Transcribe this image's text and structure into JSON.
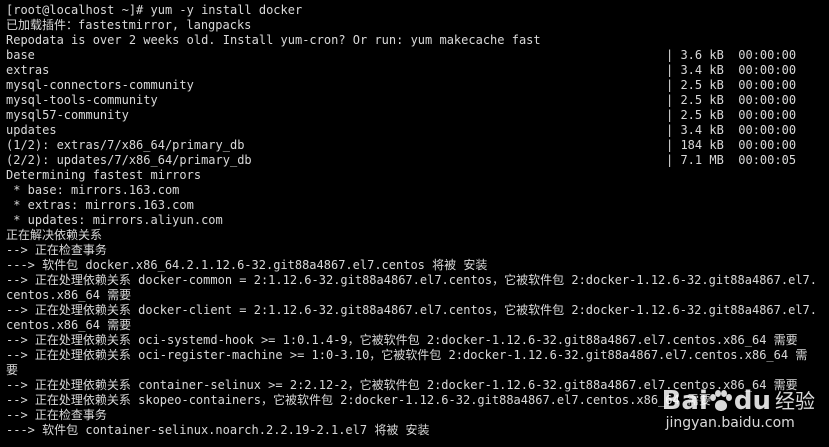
{
  "terminal": {
    "lines_top": [
      "[root@localhost ~]# yum -y install docker",
      "已加载插件：fastestmirror, langpacks",
      "Repodata is over 2 weeks old. Install yum-cron? Or run: yum makecache fast"
    ],
    "repos": [
      {
        "name": "base",
        "stat": "| 3.6 kB  00:00:00"
      },
      {
        "name": "extras",
        "stat": "| 3.4 kB  00:00:00"
      },
      {
        "name": "mysql-connectors-community",
        "stat": "| 2.5 kB  00:00:00"
      },
      {
        "name": "mysql-tools-community",
        "stat": "| 2.5 kB  00:00:00"
      },
      {
        "name": "mysql57-community",
        "stat": "| 2.5 kB  00:00:00"
      },
      {
        "name": "updates",
        "stat": "| 3.4 kB  00:00:00"
      },
      {
        "name": "(1/2): extras/7/x86_64/primary_db",
        "stat": "| 184 kB  00:00:00"
      },
      {
        "name": "(2/2): updates/7/x86_64/primary_db",
        "stat": "| 7.1 MB  00:00:05"
      }
    ],
    "lines_bottom": [
      "Determining fastest mirrors",
      " * base: mirrors.163.com",
      " * extras: mirrors.163.com",
      " * updates: mirrors.aliyun.com",
      "正在解决依赖关系",
      "--> 正在检查事务",
      "---> 软件包 docker.x86_64.2.1.12.6-32.git88a4867.el7.centos 将被 安装",
      "--> 正在处理依赖关系 docker-common = 2:1.12.6-32.git88a4867.el7.centos，它被软件包 2:docker-1.12.6-32.git88a4867.el7.",
      "centos.x86_64 需要",
      "--> 正在处理依赖关系 docker-client = 2:1.12.6-32.git88a4867.el7.centos，它被软件包 2:docker-1.12.6-32.git88a4867.el7.",
      "centos.x86_64 需要",
      "--> 正在处理依赖关系 oci-systemd-hook >= 1:0.1.4-9，它被软件包 2:docker-1.12.6-32.git88a4867.el7.centos.x86_64 需要",
      "--> 正在处理依赖关系 oci-register-machine >= 1:0-3.10，它被软件包 2:docker-1.12.6-32.git88a4867.el7.centos.x86_64 需",
      "要",
      "--> 正在处理依赖关系 container-selinux >= 2:2.12-2，它被软件包 2:docker-1.12.6-32.git88a4867.el7.centos.x86_64 需要",
      "--> 正在处理依赖关系 skopeo-containers，它被软件包 2:docker-1.12.6-32.git88a4867.el7.centos.x86_64 需要",
      "--> 正在检查事务",
      "---> 软件包 container-selinux.noarch.2.2.19-2.1.el7 将被 安装"
    ]
  },
  "watermark": {
    "brand_left": "Bai",
    "brand_right": "du",
    "brand_suffix": "经验",
    "url": "jingyan.baidu.com"
  },
  "colors": {
    "background": "#000000",
    "text": "#d9d9d9"
  }
}
